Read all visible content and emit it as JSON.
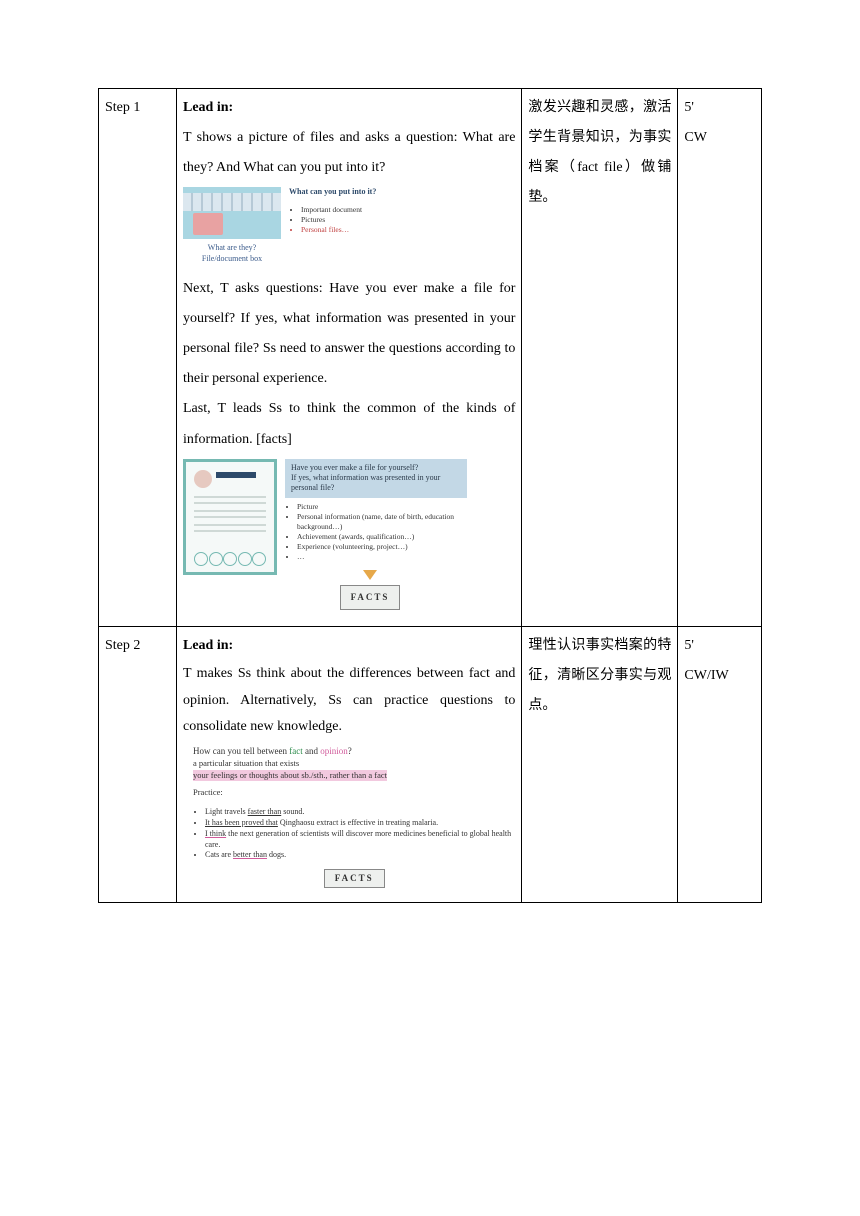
{
  "rows": [
    {
      "step": "Step 1",
      "lead_label": "Lead in:",
      "p1": "T shows a picture of files and asks a question: What are they? And What can you put into it?",
      "thumb1_q": "What can you put into it?",
      "thumb1_items": [
        "Important document",
        "Pictures",
        "Personal files…"
      ],
      "thumb1_caption_q": "What are they?",
      "thumb1_caption_a": "File/document box",
      "p2": "Next, T asks questions: Have you ever make a file for yourself? If yes, what information was presented in your personal file? Ss need to answer the questions according to their personal experience.",
      "p3": "Last, T leads Ss to think the common of the kinds of information. [facts]",
      "thumb2_q1": "Have you ever make a file for yourself?",
      "thumb2_q2": "If yes, what information was presented in your personal file?",
      "thumb2_items": [
        "Picture",
        "Personal information (name, date of birth, education background…)",
        "Achievement (awards, qualification…)",
        "Experience (volunteering, project…)",
        "…"
      ],
      "facts_label": "FACTS",
      "purpose": "激发兴趣和灵感，激活学生背景知识，为事实档案（fact file）做铺垫。",
      "time": "5'",
      "mode": "CW"
    },
    {
      "step": "Step 2",
      "lead_label": "Lead in:",
      "p1": "T makes Ss think about the differences between fact and opinion. Alternatively, Ss can practice questions to consolidate new knowledge.",
      "chart": {
        "title_pre": "How can you tell between ",
        "fact_word": "fact",
        "and": " and ",
        "opinion_word": "opinion",
        "qmark": "?",
        "def_fact": "a particular situation that exists",
        "def_opinion": "your feelings or thoughts about sb./sth., rather than a fact",
        "practice_label": "Practice:",
        "items": [
          "Light travels faster than sound.",
          "It has been proved that Qinghaosu extract is effective in treating malaria.",
          "I think the next generation of scientists will discover more medicines beneficial to global health care.",
          "Cats are better than dogs."
        ],
        "facts_label": "FACTS"
      },
      "purpose": "理性认识事实档案的特征，清晰区分事实与观点。",
      "time": "5'",
      "mode": "CW/IW"
    }
  ]
}
